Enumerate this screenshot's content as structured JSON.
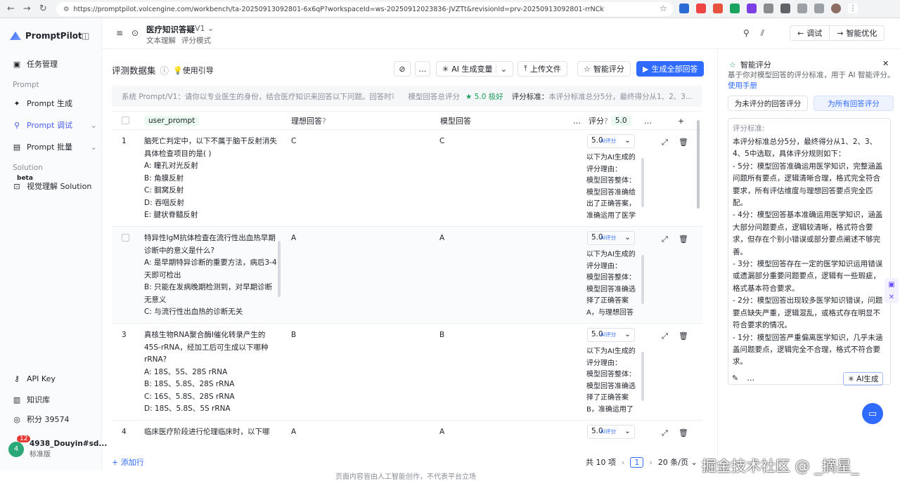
{
  "browser": {
    "url": "https://promptpilot.volcengine.com/workbench/ta-20250913092801-6x6qP?workspaceId=ws-20250912023836-JVZTt&revisionId=prv-20250913092801-rrNCk"
  },
  "sidebar": {
    "brand": "PromptPilot",
    "task_mgmt": "任务管理",
    "section_prompt": "Prompt",
    "items": [
      "Prompt 生成",
      "Prompt 调试",
      "Prompt 批量"
    ],
    "section_solution": "Solution",
    "beta": "beta",
    "solution_item": "视觉理解 Solution",
    "api_key": "API Key",
    "kb": "知识库",
    "points": "积分 39574",
    "user_badge": "12",
    "user_initial": "4",
    "user_name": "4938_Douyin#sd...",
    "user_plan": "标准版"
  },
  "header": {
    "title": "医疗知识答疑",
    "version": "V1",
    "sub1": "文本理解",
    "sub2": "评分模式",
    "debug": "调试",
    "optimize": "智能优化"
  },
  "toolbar": {
    "dataset": "评测数据集",
    "guide": "使用引导",
    "ai_var": "AI 生成变量",
    "upload": "上传文件",
    "smart_score": "智能评分",
    "gen_all": "生成全部回答"
  },
  "sysbar": {
    "label": "系统 Prompt/V1：",
    "text": "请你以专业医生的身份，结合医疗知识来回答以下问题。回答时可...",
    "score_label": "模型回答总评分",
    "score": "5.0 极好",
    "std_label": "评分标准：",
    "std_text": "本评分标准总分5分，最终得分从1、2、3..."
  },
  "table": {
    "headers": {
      "prompt": "user_prompt",
      "ideal": "理想回答",
      "model": "模型回答",
      "score": "评分",
      "score_val": "5.0",
      "add": "+"
    },
    "ai_badge": "AI评分",
    "rows": [
      {
        "num": "1",
        "prompt": "脑死亡判定中，以下不属于脑干反射消失具体检查项目的是( )\nA: 瞳孔对光反射\nB: 角膜反射\nC: 腘窝反射\nD: 吞咽反射\nE: 腱状脊髓反射",
        "ideal": "C",
        "model": "C",
        "score": "5.0",
        "reason": "以下为AI生成的评分理由：\n模型回答整体：模型回答准确给出了正确答案，准确运用了医学知识，完整涵盖"
      },
      {
        "num": "",
        "prompt": "特异性IgM抗体检查在流行性出血热早期诊断中的意义是什么?\nA: 是早期特异诊断的重要方法，病后3-4天即可检出\nB: 只能在发病晚期检测到，对早期诊断无意义\nC: 与流行性出血热的诊断无关\nD: 仅能检测出部分流行性出血热患者",
        "ideal": "A",
        "model": "A",
        "score": "5.0",
        "reason": "以下为AI生成的评分理由：\n模型回答整体：模型回答准确选择了正确答案A，与理想回答完全匹配。准确运用"
      },
      {
        "num": "3",
        "prompt": "真核生物RNA聚合酶I催化转录产生的45S-rRNA，经加工后可生成以下哪种rRNA?\nA: 18S、5S、28S rRNA\nB: 18S、5.8S、28S rRNA\nC: 16S、5.8S、28S rRNA\nD: 18S、5.8S、5S rRNA",
        "ideal": "B",
        "model": "B",
        "score": "5.0",
        "reason": "以下为AI生成的评分理由：\n模型回答整体：模型回答准确选择了正确答案B，准确运用了医学知识，完整涵盖"
      },
      {
        "num": "4",
        "prompt": "临床医疗阶段进行伦理临床时，以下哪",
        "ideal": "A",
        "model": "A",
        "score": "5.0",
        "reason": ""
      }
    ]
  },
  "footer": {
    "add_row": "添加行",
    "total": "共 10 项",
    "page": "1",
    "page_size": "20 条/页",
    "notice": "页面内容皆由人工智能创作，不代表平台立场"
  },
  "right_panel": {
    "title": "智能评分",
    "desc": "基于你对模型回答的评分标准，用于 AI 智能评分。",
    "link": "使用手册",
    "btn_unscored": "为未评分的回答评分",
    "btn_all": "为所有回答评分",
    "std_label": "评分标准:",
    "std_text": "本评分标准总分5分，最终得分从1、2、3、4、5中选取，具体评分规则如下：\n- 5分：模型回答准确运用医学知识，完整涵盖问题所有要点，逻辑清晰合理，格式完全符合要求，所有评估维度与理想回答要点完全匹配。\n- 4分：模型回答基本准确运用医学知识，涵盖大部分问题要点，逻辑较清晰，格式符合要求，但存在个别小错误或部分要点阐述不够完善。\n- 3分：模型回答存在一定的医学知识运用错误或遗漏部分重要问题要点，逻辑有一些瑕疵，格式基本符合要求。\n- 2分：模型回答出现较多医学知识错误，问题要点缺失严重，逻辑混乱，或格式存在明显不符合要求的情况。\n- 1分：模型回答严重偏离医学知识，几乎未涵盖问题要点，逻辑完全不合理，格式不符合要求。",
    "ai_gen": "AI生成"
  },
  "watermark": "掘金技术社区 @ _摘星_"
}
